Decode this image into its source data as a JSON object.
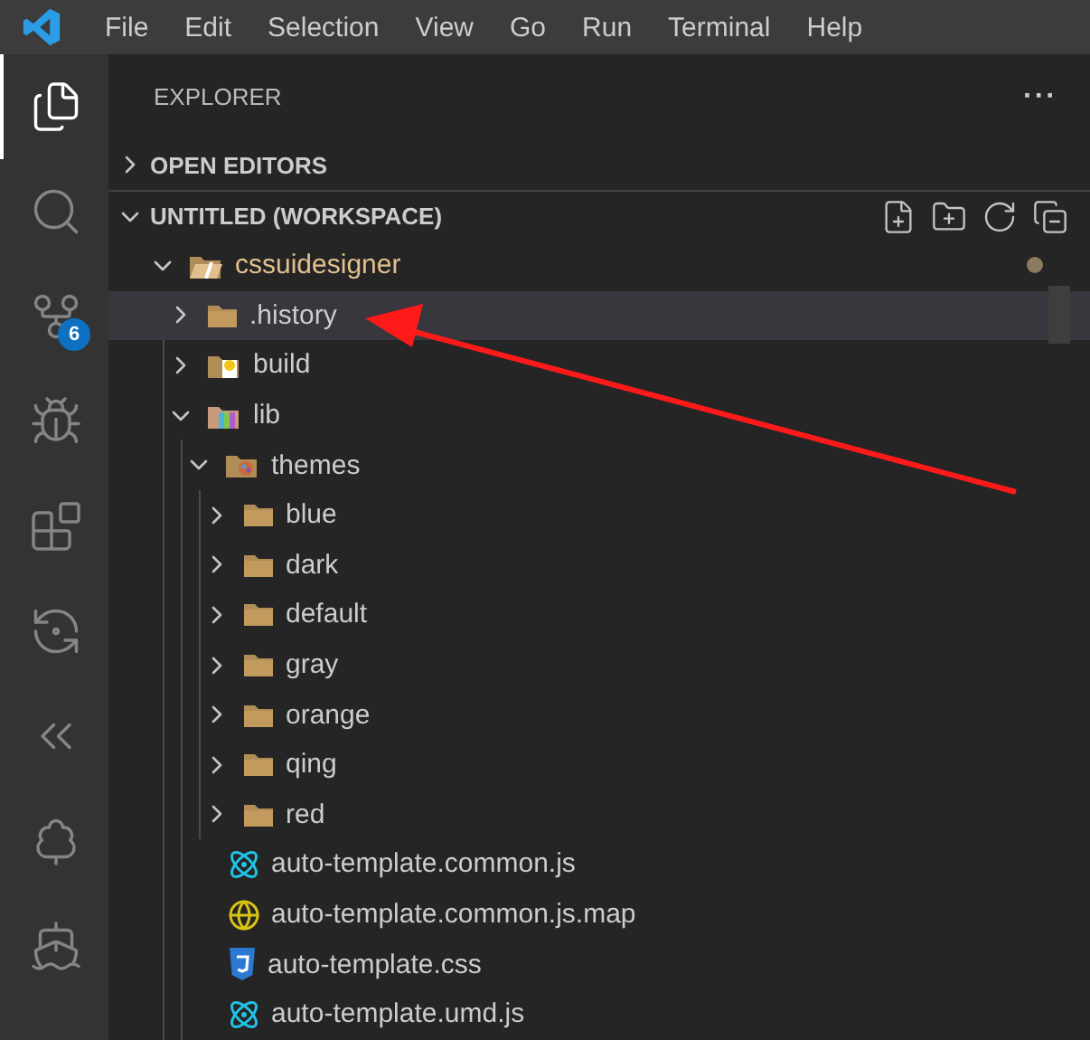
{
  "menu": [
    "File",
    "Edit",
    "Selection",
    "View",
    "Go",
    "Run",
    "Terminal",
    "Help"
  ],
  "activity": [
    {
      "kind": "files",
      "selected": true
    },
    {
      "kind": "search",
      "selected": false
    },
    {
      "kind": "source-control",
      "selected": false,
      "badge": "6"
    },
    {
      "kind": "debug",
      "selected": false
    },
    {
      "kind": "extensions",
      "selected": false
    },
    {
      "kind": "diff",
      "selected": false
    },
    {
      "kind": "graph",
      "selected": false
    },
    {
      "kind": "tree",
      "selected": false
    },
    {
      "kind": "docker",
      "selected": false
    }
  ],
  "explorer": {
    "title": "EXPLORER",
    "more": "···",
    "sections": [
      {
        "title": "OPEN EDITORS",
        "expanded": false
      },
      {
        "title": "UNTITLED (WORKSPACE)",
        "expanded": true
      }
    ],
    "tree": [
      {
        "name": "cssuidesigner",
        "kind": "root",
        "expanded": true,
        "selected": false,
        "modified": true,
        "children": [
          {
            "name": ".history",
            "kind": "folder",
            "expanded": false,
            "selected": true
          },
          {
            "name": "build",
            "kind": "build",
            "expanded": false,
            "selected": false
          },
          {
            "name": "lib",
            "kind": "lib",
            "expanded": true,
            "selected": false,
            "children": [
              {
                "name": "themes",
                "kind": "theme",
                "expanded": true,
                "selected": false,
                "children": [
                  {
                    "name": "blue",
                    "kind": "folder",
                    "expanded": false,
                    "selected": false
                  },
                  {
                    "name": "dark",
                    "kind": "folder",
                    "expanded": false,
                    "selected": false
                  },
                  {
                    "name": "default",
                    "kind": "folder",
                    "expanded": false,
                    "selected": false
                  },
                  {
                    "name": "gray",
                    "kind": "folder",
                    "expanded": false,
                    "selected": false
                  },
                  {
                    "name": "orange",
                    "kind": "folder",
                    "expanded": false,
                    "selected": false
                  },
                  {
                    "name": "qing",
                    "kind": "folder",
                    "expanded": false,
                    "selected": false
                  },
                  {
                    "name": "red",
                    "kind": "folder",
                    "expanded": false,
                    "selected": false
                  }
                ]
              },
              {
                "name": "auto-template.common.js",
                "kind": "react",
                "selected": false
              },
              {
                "name": "auto-template.common.js.map",
                "kind": "map",
                "selected": false
              },
              {
                "name": "auto-template.css",
                "kind": "css",
                "selected": false
              },
              {
                "name": "auto-template.umd.js",
                "kind": "react",
                "selected": false
              }
            ]
          }
        ]
      }
    ]
  },
  "annotation": {
    "kind": "arrow"
  }
}
